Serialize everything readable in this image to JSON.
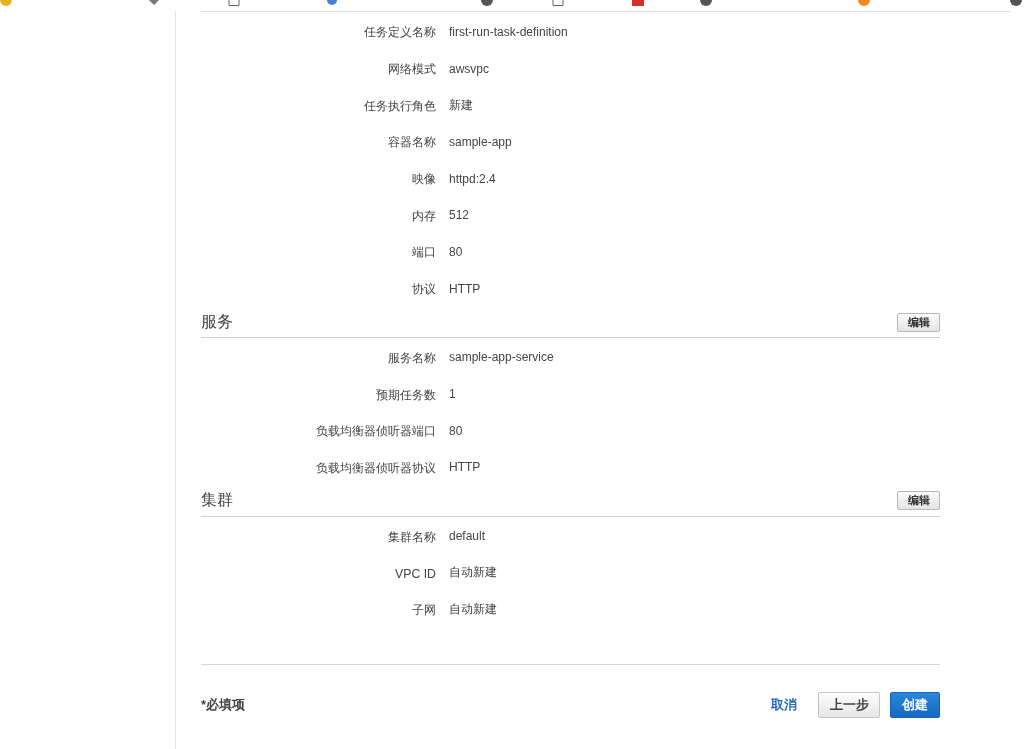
{
  "task_definition": {
    "rows": [
      {
        "label": "任务定义名称",
        "value": "first-run-task-definition"
      },
      {
        "label": "网络模式",
        "value": "awsvpc"
      },
      {
        "label": "任务执行角色",
        "value": "新建"
      },
      {
        "label": "容器名称",
        "value": "sample-app"
      },
      {
        "label": "映像",
        "value": "httpd:2.4"
      },
      {
        "label": "内存",
        "value": "512"
      },
      {
        "label": "端口",
        "value": "80"
      },
      {
        "label": "协议",
        "value": "HTTP"
      }
    ]
  },
  "sections": [
    {
      "title": "服务",
      "edit_button": "编辑",
      "rows": [
        {
          "label": "服务名称",
          "value": "sample-app-service"
        },
        {
          "label": "预期任务数",
          "value": "1"
        },
        {
          "label": "负载均衡器侦听器端口",
          "value": "80"
        },
        {
          "label": "负载均衡器侦听器协议",
          "value": "HTTP"
        }
      ]
    },
    {
      "title": "集群",
      "edit_button": "编辑",
      "rows": [
        {
          "label": "集群名称",
          "value": "default"
        },
        {
          "label": "VPC ID",
          "value": "自动新建"
        },
        {
          "label": "子网",
          "value": "自动新建"
        }
      ]
    }
  ],
  "footer": {
    "required_note": "*必填项",
    "buttons": [
      {
        "kind": "link",
        "label": "取消"
      },
      {
        "kind": "secondary",
        "label": "上一步"
      },
      {
        "kind": "primary",
        "label": "创建"
      }
    ]
  }
}
